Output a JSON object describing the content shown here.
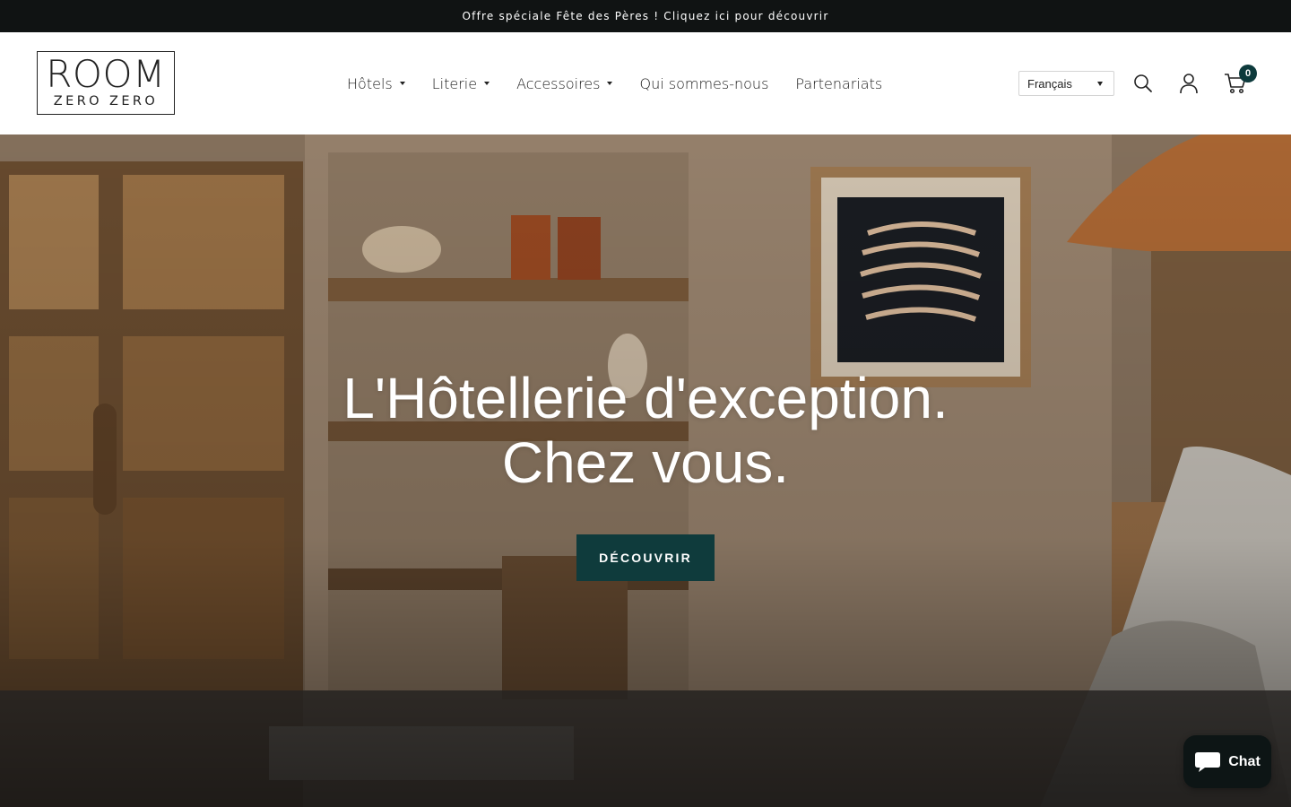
{
  "announcement": "Offre spéciale Fête des Pères ! Cliquez ici pour découvrir",
  "logo": {
    "line1": "ROOM",
    "line2": "ZERO ZERO"
  },
  "nav": [
    {
      "label": "Hôtels",
      "dropdown": true
    },
    {
      "label": "Literie",
      "dropdown": true
    },
    {
      "label": "Accessoires",
      "dropdown": true
    },
    {
      "label": "Qui sommes-nous",
      "dropdown": false
    },
    {
      "label": "Partenariats",
      "dropdown": false
    }
  ],
  "language": "Français",
  "cart_count": "0",
  "icons": {
    "search": "search-icon",
    "account": "user-icon",
    "cart": "cart-icon",
    "chat": "chat-bubble-icon"
  },
  "hero": {
    "title_line1": "L'Hôtellerie d'exception.",
    "title_line2": "Chez vous.",
    "cta": "DÉCOUVRIR"
  },
  "chat": {
    "label": "Chat"
  },
  "colors": {
    "accent": "#0f3b3c",
    "announcement_bg": "#101313"
  }
}
